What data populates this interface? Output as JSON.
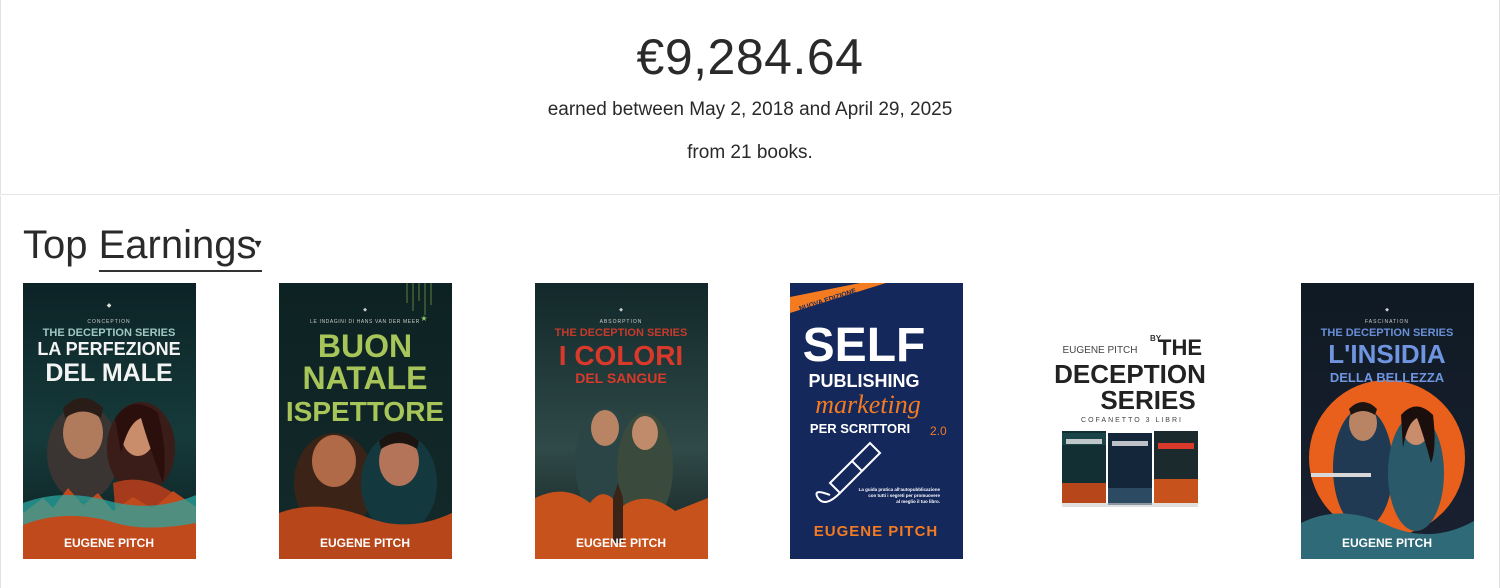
{
  "summary": {
    "amount": "€9,284.64",
    "range": "earned between May 2, 2018 and April 29, 2025",
    "count": "from 21 books."
  },
  "section": {
    "title_prefix": "Top",
    "title_dropdown": "Earnings",
    "caret": "▾"
  },
  "books": [
    {
      "series_top": "CONCEPTION",
      "series": "THE DECEPTION SERIES",
      "title_line1": "LA PERFEZIONE",
      "title_line2": "DEL MALE",
      "author": "EUGENE PITCH"
    },
    {
      "series": "LE INDAGINI DI HANS VAN DER MEER",
      "title_line1": "BUON",
      "title_line2": "NATALE",
      "title_line3": "ISPETTORE",
      "author": "EUGENE PITCH"
    },
    {
      "series_top": "ABSORPTION",
      "series": "THE DECEPTION SERIES",
      "title_line1": "I COLORI",
      "title_line2": "DEL SANGUE",
      "author": "EUGENE PITCH"
    },
    {
      "badge": "NUOVA EDIZIONE",
      "title_line1": "SELF",
      "title_line2": "PUBLISHING",
      "title_line3": "marketing",
      "title_line4": "PER SCRITTORI",
      "edition": "2.0",
      "blurb_line1": "La guida pratica all'autopubblicazione",
      "blurb_line2": "con tutti i segreti per promuovere",
      "blurb_line3": "al meglio il tuo libro.",
      "author": "EUGENE PITCH"
    },
    {
      "author_top": "EUGENE PITCH",
      "by": "BY",
      "title_line1": "THE",
      "title_line2": "DECEPTION",
      "title_line3": "SERIES",
      "subtitle": "COFANETTO 3 LIBRI"
    },
    {
      "series_top": "FASCINATION",
      "series": "THE DECEPTION SERIES",
      "title_line1": "L'INSIDIA",
      "title_line2": "DELLA BELLEZZA",
      "author": "EUGENE PITCH"
    }
  ],
  "colors": {
    "cover1_bg": "#0f2a2d",
    "cover2_bg": "#102525",
    "cover3_bg": "#152a2c",
    "cover4_bg": "#14285c",
    "cover4_accent": "#f47b20",
    "cover6_bg": "#0f1d2a",
    "cover6_sun": "#e8601c"
  }
}
